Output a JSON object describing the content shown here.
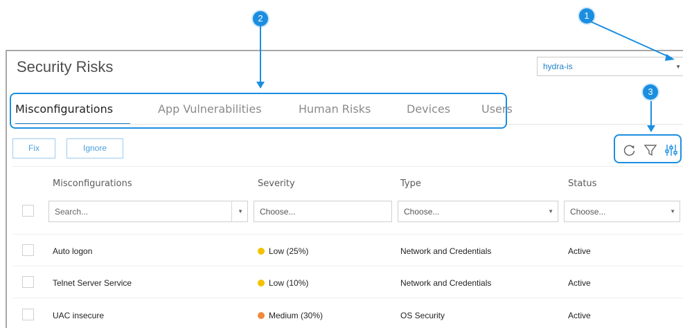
{
  "page": {
    "title": "Security Risks"
  },
  "tenant_select": {
    "value": "hydra-is"
  },
  "tabs": [
    {
      "label": "Misconfigurations",
      "active": true
    },
    {
      "label": "App Vulnerabilities",
      "active": false
    },
    {
      "label": "Human Risks",
      "active": false
    },
    {
      "label": "Devices",
      "active": false
    },
    {
      "label": "Users",
      "active": false
    }
  ],
  "actions": {
    "fix_label": "Fix",
    "ignore_label": "Ignore"
  },
  "toolbar_icons": [
    "refresh-icon",
    "filter-icon",
    "column-settings-icon"
  ],
  "columns": [
    {
      "header": "Misconfigurations",
      "filter_placeholder": "Search..."
    },
    {
      "header": "Severity",
      "filter_placeholder": "Choose..."
    },
    {
      "header": "Type",
      "filter_placeholder": "Choose..."
    },
    {
      "header": "Status",
      "filter_placeholder": "Choose..."
    }
  ],
  "rows": [
    {
      "name": "Auto logon",
      "severity": "Low (25%)",
      "severity_color": "#f2c200",
      "type": "Network and Credentials",
      "status": "Active"
    },
    {
      "name": "Telnet Server Service",
      "severity": "Low (10%)",
      "severity_color": "#f2c200",
      "type": "Network and Credentials",
      "status": "Active"
    },
    {
      "name": "UAC insecure",
      "severity": "Medium (30%)",
      "severity_color": "#ef8a3c",
      "type": "OS Security",
      "status": "Active"
    }
  ],
  "callouts": [
    "1",
    "2",
    "3"
  ],
  "colors": {
    "accent": "#1b8ee0",
    "low": "#f2c200",
    "medium": "#ef8a3c"
  }
}
